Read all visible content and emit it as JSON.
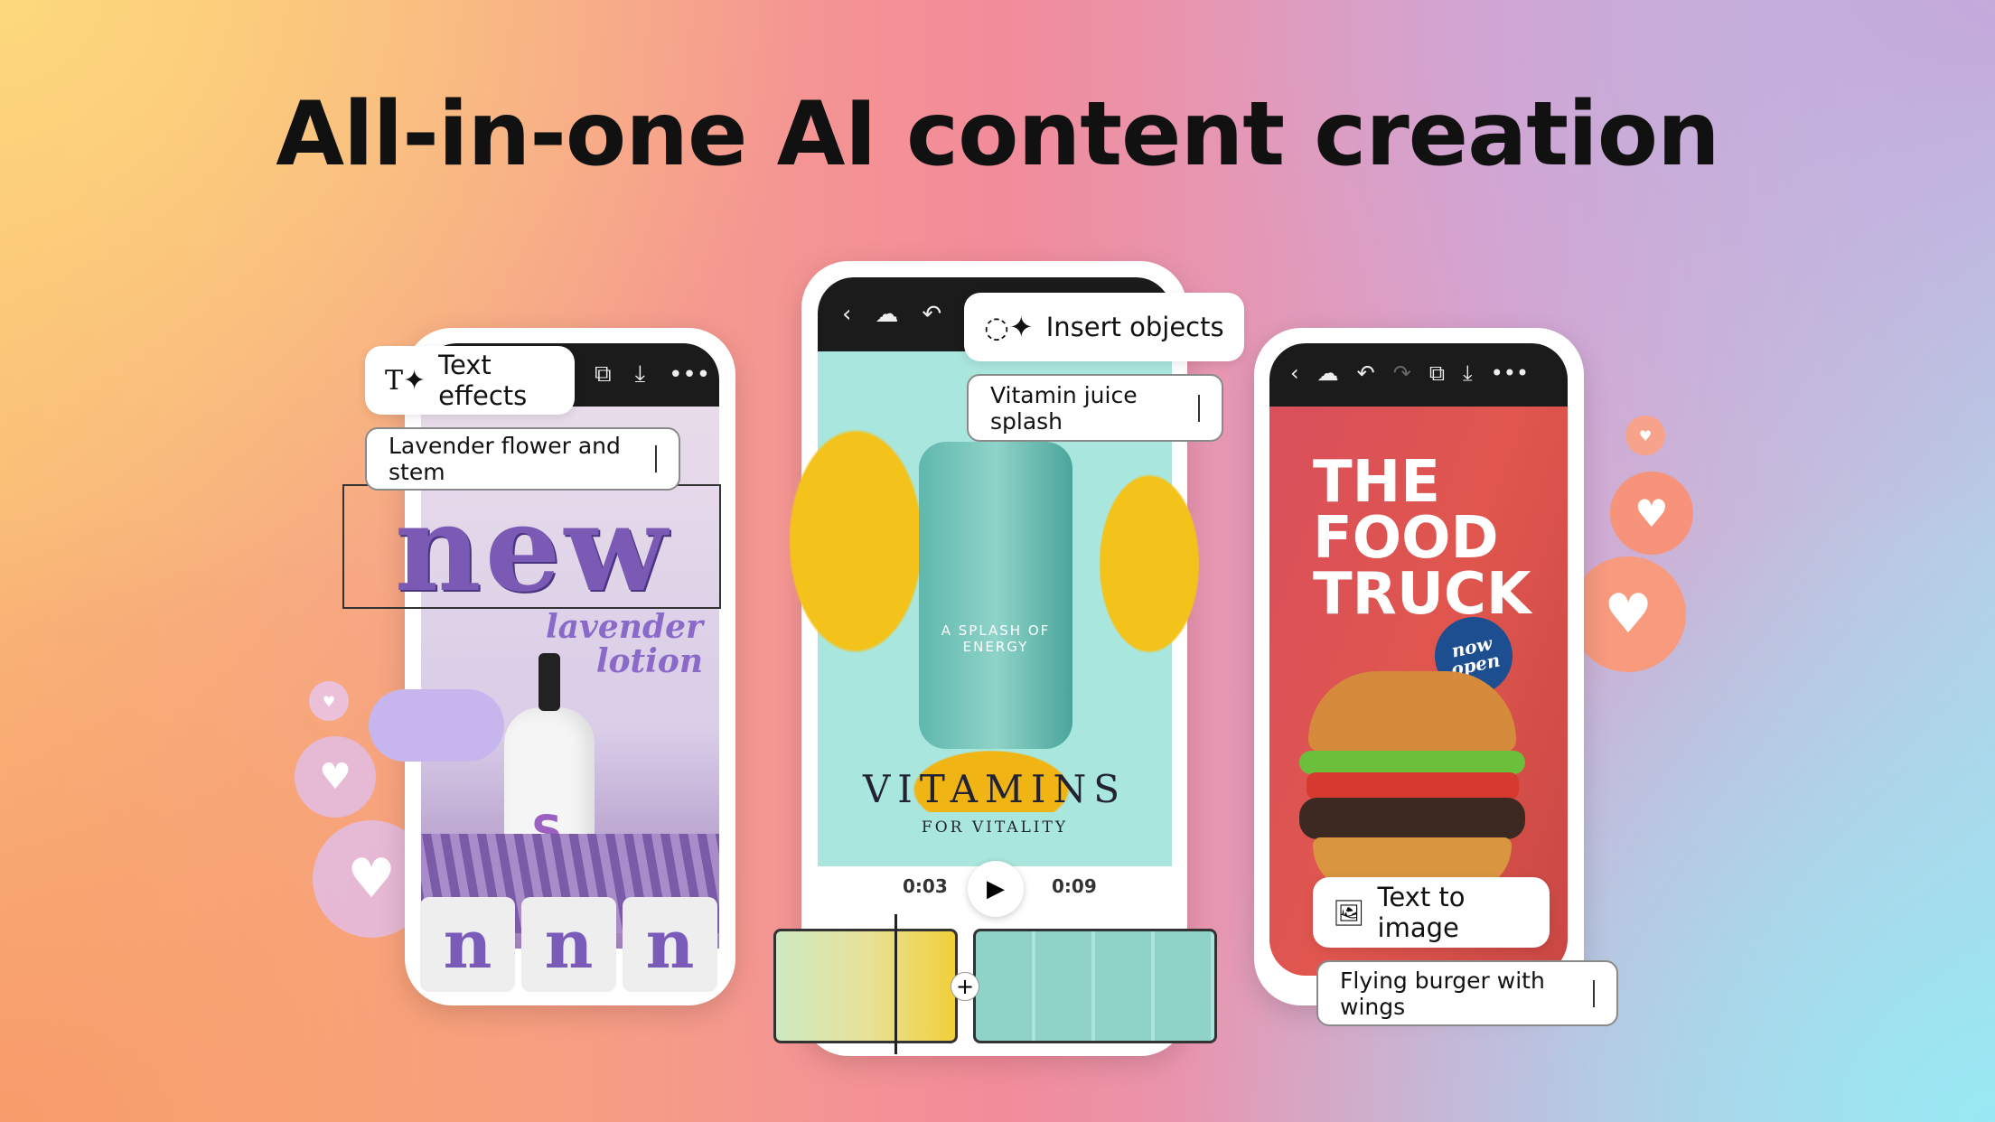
{
  "headline": "All-in-one AI content creation",
  "left_card": {
    "feature": "Text effects",
    "prompt": "Lavender flower and stem",
    "art_word": "new",
    "product_text": "lavender lotion",
    "thumbnails": [
      "n",
      "n",
      "n"
    ],
    "icons": [
      "copy-icon",
      "download-icon",
      "more-icon"
    ]
  },
  "center_card": {
    "feature": "Insert objects",
    "prompt": "Vitamin juice splash",
    "jar_text": "A SPLASH OF ENERGY",
    "brand": "VITAMINS",
    "tagline": "FOR VITALITY",
    "time_current": "0:03",
    "time_total": "0:09",
    "icons": [
      "back-icon",
      "cloud-icon",
      "undo-icon"
    ]
  },
  "right_card": {
    "feature": "Text to image",
    "prompt": "Flying burger with wings",
    "poster_title": "THE FOOD TRUCK",
    "badge": "now open",
    "icons": [
      "back-icon",
      "cloud-icon",
      "undo-icon",
      "redo-icon",
      "copy-icon",
      "download-icon",
      "more-icon"
    ]
  },
  "colors": {
    "title": "#111111",
    "toolbar": "#1b1b1b",
    "teal": "#a9e6de",
    "poster_red": "#e0564e",
    "lavender": "#8a6ac8"
  }
}
